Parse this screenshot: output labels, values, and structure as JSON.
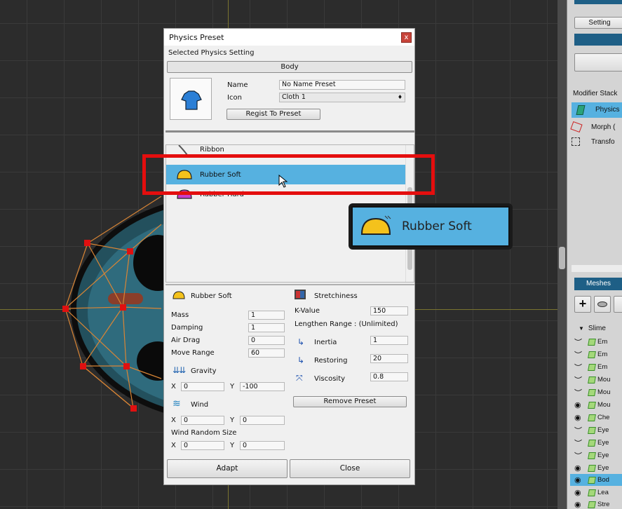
{
  "dialog": {
    "title": "Physics Preset",
    "section_label": "Selected Physics Setting",
    "target_label": "Body",
    "name_label": "Name",
    "name_value": "No Name Preset",
    "icon_label": "Icon",
    "icon_value": "Cloth 1",
    "regist_button": "Regist To Preset",
    "presets": [
      {
        "label": "Ribbon",
        "icon": "ribbon-icon"
      },
      {
        "label": "Rubber Soft",
        "icon": "rubber-soft-icon",
        "selected": true
      },
      {
        "label": "Rubber Hard",
        "icon": "rubber-hard-icon"
      }
    ],
    "detail": {
      "preset_name": "Rubber Soft",
      "mass_label": "Mass",
      "mass": "1",
      "damping_label": "Damping",
      "damping": "1",
      "air_drag_label": "Air Drag",
      "air_drag": "0",
      "move_range_label": "Move Range",
      "move_range": "60",
      "gravity_label": "Gravity",
      "gravity_x": "0",
      "gravity_y": "-100",
      "wind_label": "Wind",
      "wind_x": "0",
      "wind_y": "0",
      "wind_random_label": "Wind Random Size",
      "wind_random_x": "0",
      "wind_random_y": "0",
      "x_label": "X",
      "y_label": "Y",
      "stretchiness_label": "Stretchiness",
      "k_value_label": "K-Value",
      "k_value": "150",
      "lengthen_range_label": "Lengthen Range : (Unlimited)",
      "inertia_label": "Inertia",
      "inertia": "1",
      "restoring_label": "Restoring",
      "restoring": "20",
      "viscosity_label": "Viscosity",
      "viscosity": "0.8",
      "remove_button": "Remove Preset"
    },
    "adapt_button": "Adapt",
    "close_button": "Close",
    "close_glyph": "x"
  },
  "zoom_callout": {
    "label": "Rubber Soft"
  },
  "right_panel": {
    "setting_button": "Setting",
    "modifier_stack_label": "Modifier Stack",
    "modifiers": [
      "Physics",
      "Morph (",
      "Transfo"
    ],
    "meshes_label": "Meshes",
    "tree_root": "Slime",
    "mesh_rows": [
      "Em",
      "Em",
      "Em",
      "Mou",
      "Mou",
      "Mou",
      "Che",
      "Eye",
      "Eye",
      "Eye",
      "Eye",
      "Bod",
      "Lea",
      "Stre"
    ]
  },
  "colors": {
    "selection": "#56b1e0",
    "highlight": "#e40e0e",
    "slime_body": "#2a5e6e",
    "handle": "#e01010"
  }
}
